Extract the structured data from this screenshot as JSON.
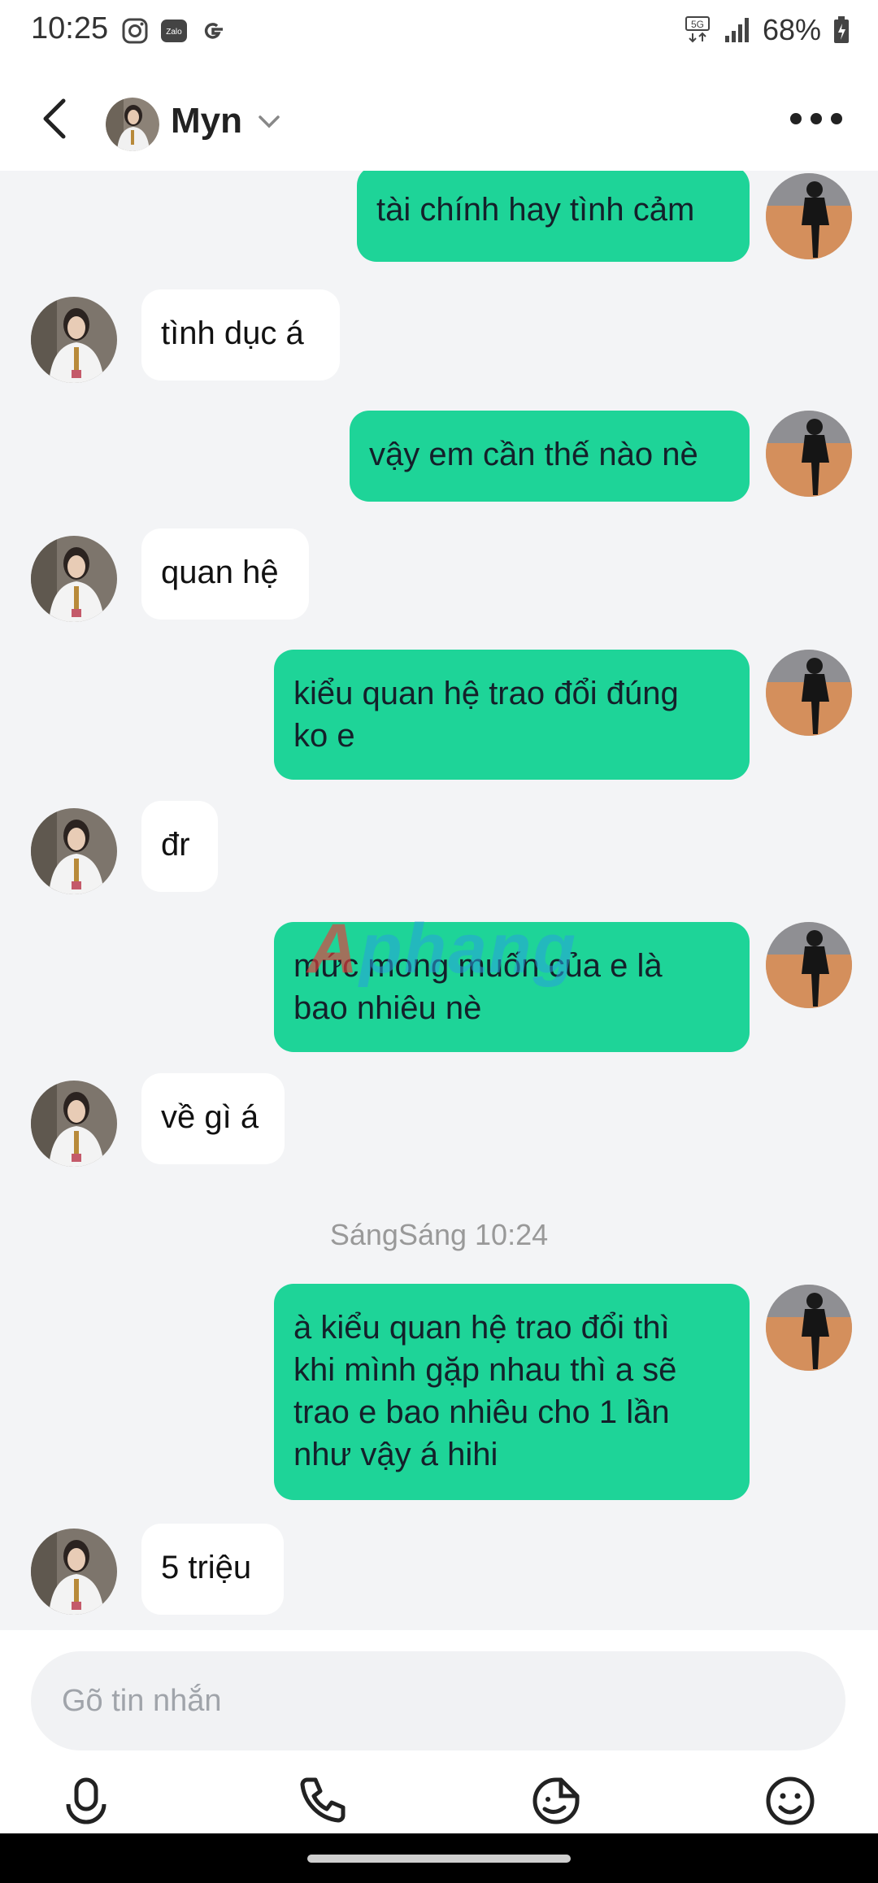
{
  "status_bar": {
    "time": "10:25",
    "battery": "68%",
    "network": "5G"
  },
  "header": {
    "contact_name": "Myn"
  },
  "messages": [
    {
      "side": "sent",
      "lines": [
        "tài chính hay tình cảm"
      ]
    },
    {
      "side": "recv",
      "lines": [
        "tình dục á"
      ]
    },
    {
      "side": "sent",
      "lines": [
        "vậy em cần thế nào nè"
      ]
    },
    {
      "side": "recv",
      "lines": [
        "quan hệ"
      ]
    },
    {
      "side": "sent",
      "lines": [
        "kiểu quan hệ trao đổi đúng",
        "ko e"
      ]
    },
    {
      "side": "recv",
      "lines": [
        "đr"
      ]
    },
    {
      "side": "sent",
      "lines": [
        "mức mong muốn của e là",
        "bao nhiêu nè"
      ]
    },
    {
      "side": "recv",
      "lines": [
        "về gì á"
      ]
    },
    {
      "side": "sent",
      "lines": [
        "à kiểu quan hệ trao đổi thì",
        "khi mình gặp nhau thì a sẽ",
        "trao e bao nhiêu cho 1 lần",
        "như vậy á hihi"
      ]
    },
    {
      "side": "recv",
      "lines": [
        "5 triệu"
      ]
    }
  ],
  "timestamp": "SángSáng 10:24",
  "watermark": {
    "first": "A",
    "rest": "phang"
  },
  "composer": {
    "placeholder": "Gõ tin nhắn"
  },
  "icons": [
    "back-arrow-icon",
    "chevron-down-icon",
    "more-icon",
    "microphone-icon",
    "phone-icon",
    "sticker-icon",
    "emoji-icon"
  ],
  "colors": {
    "sent_bubble": "#1ed498",
    "recv_bubble": "#ffffff",
    "background": "#f3f4f6"
  }
}
